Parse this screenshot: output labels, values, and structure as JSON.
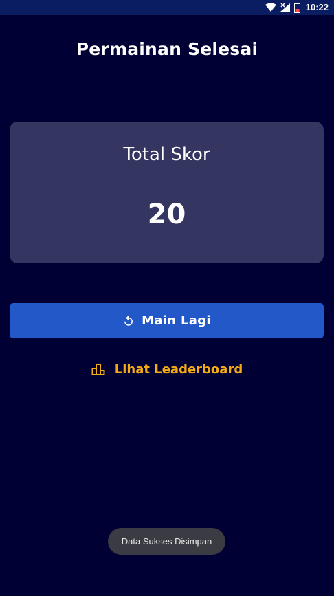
{
  "status_bar": {
    "time": "10:22",
    "icons": [
      "wifi-icon",
      "signal-icon",
      "battery-icon"
    ]
  },
  "page": {
    "title": "Permainan Selesai"
  },
  "score_card": {
    "label": "Total Skor",
    "value": "20"
  },
  "actions": {
    "play_again": {
      "label": "Main Lagi",
      "icon": "replay-icon"
    },
    "leaderboard": {
      "label": "Lihat Leaderboard",
      "icon": "leaderboard-icon"
    }
  },
  "toast": {
    "message": "Data Sukses Disimpan"
  },
  "colors": {
    "background": "#000034",
    "status_bar": "#0a1c62",
    "card": "#353562",
    "primary_button": "#2358c8",
    "accent": "#f5ab16",
    "toast": "#3b3b44"
  }
}
